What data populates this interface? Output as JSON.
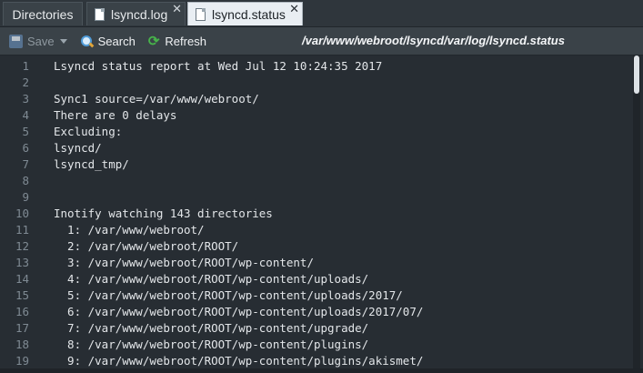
{
  "tabs": [
    {
      "label": "Directories"
    },
    {
      "label": "lsyncd.log",
      "close": "✕"
    },
    {
      "label": "lsyncd.status",
      "close": "✕"
    }
  ],
  "toolbar": {
    "save_label": "Save",
    "search_label": "Search",
    "refresh_label": "Refresh",
    "path": "/var/www/webroot/lsyncd/var/log/lsyncd.status"
  },
  "editor": {
    "lines": [
      {
        "n": "1",
        "text": "Lsyncd status report at Wed Jul 12 10:24:35 2017"
      },
      {
        "n": "2",
        "text": ""
      },
      {
        "n": "3",
        "text": "Sync1 source=/var/www/webroot/"
      },
      {
        "n": "4",
        "text": "There are 0 delays"
      },
      {
        "n": "5",
        "text": "Excluding:"
      },
      {
        "n": "6",
        "text": "lsyncd/"
      },
      {
        "n": "7",
        "text": "lsyncd_tmp/"
      },
      {
        "n": "8",
        "text": ""
      },
      {
        "n": "9",
        "text": ""
      },
      {
        "n": "10",
        "text": "Inotify watching 143 directories"
      },
      {
        "n": "11",
        "text": "  1: /var/www/webroot/"
      },
      {
        "n": "12",
        "text": "  2: /var/www/webroot/ROOT/"
      },
      {
        "n": "13",
        "text": "  3: /var/www/webroot/ROOT/wp-content/"
      },
      {
        "n": "14",
        "text": "  4: /var/www/webroot/ROOT/wp-content/uploads/"
      },
      {
        "n": "15",
        "text": "  5: /var/www/webroot/ROOT/wp-content/uploads/2017/"
      },
      {
        "n": "16",
        "text": "  6: /var/www/webroot/ROOT/wp-content/uploads/2017/07/"
      },
      {
        "n": "17",
        "text": "  7: /var/www/webroot/ROOT/wp-content/upgrade/"
      },
      {
        "n": "18",
        "text": "  8: /var/www/webroot/ROOT/wp-content/plugins/"
      },
      {
        "n": "19",
        "text": "  9: /var/www/webroot/ROOT/wp-content/plugins/akismet/"
      }
    ]
  },
  "colors": {
    "accent": "#4f9bd8",
    "refresh": "#47b34a",
    "active_tab": "#e9eef3"
  }
}
